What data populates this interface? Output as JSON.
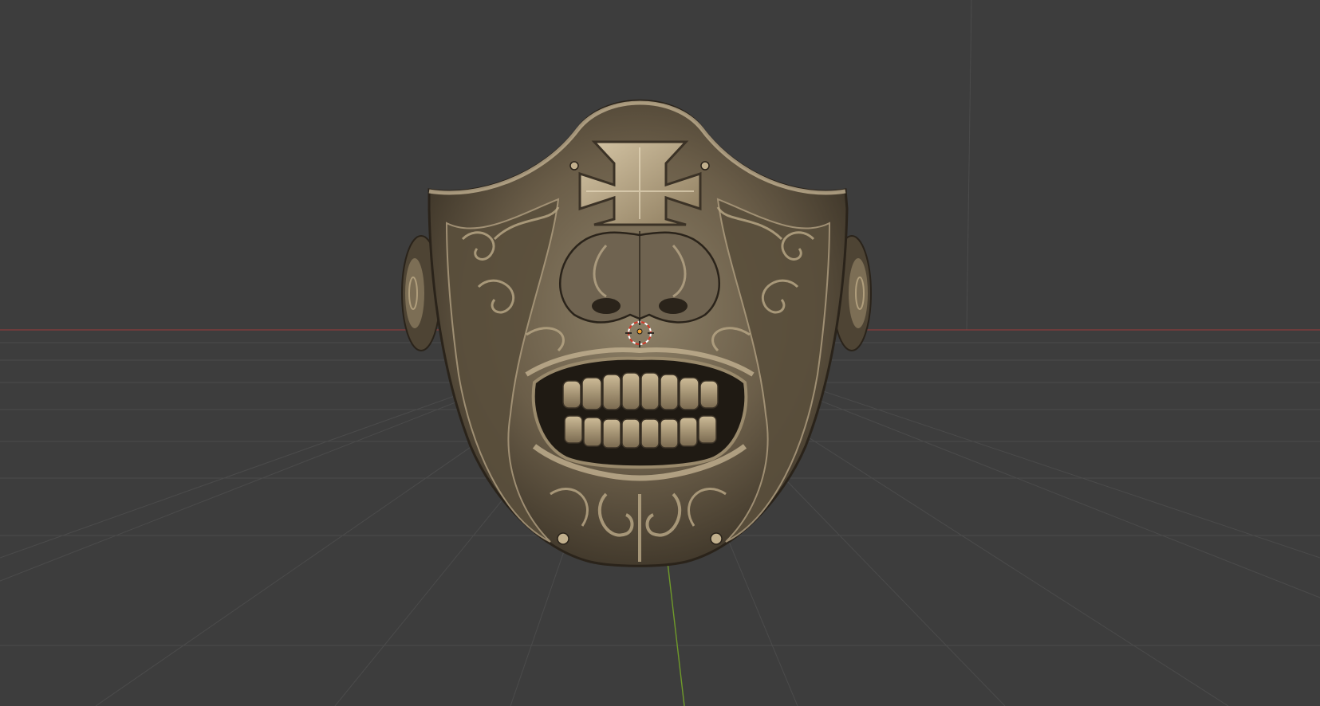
{
  "viewport": {
    "background_color": "#3d3d3d",
    "grid_color": "#4e4e4e",
    "x_axis_color": "#8a3d3d",
    "y_axis_color": "#6f9a2a",
    "object": {
      "name_icon": "mask-mesh",
      "base_color": "#6b5e49",
      "highlight_color": "#c8b797",
      "shadow_color": "#2a231a"
    },
    "cursor_icon": "3d-cursor-icon",
    "origin_icon": "object-origin-icon"
  }
}
